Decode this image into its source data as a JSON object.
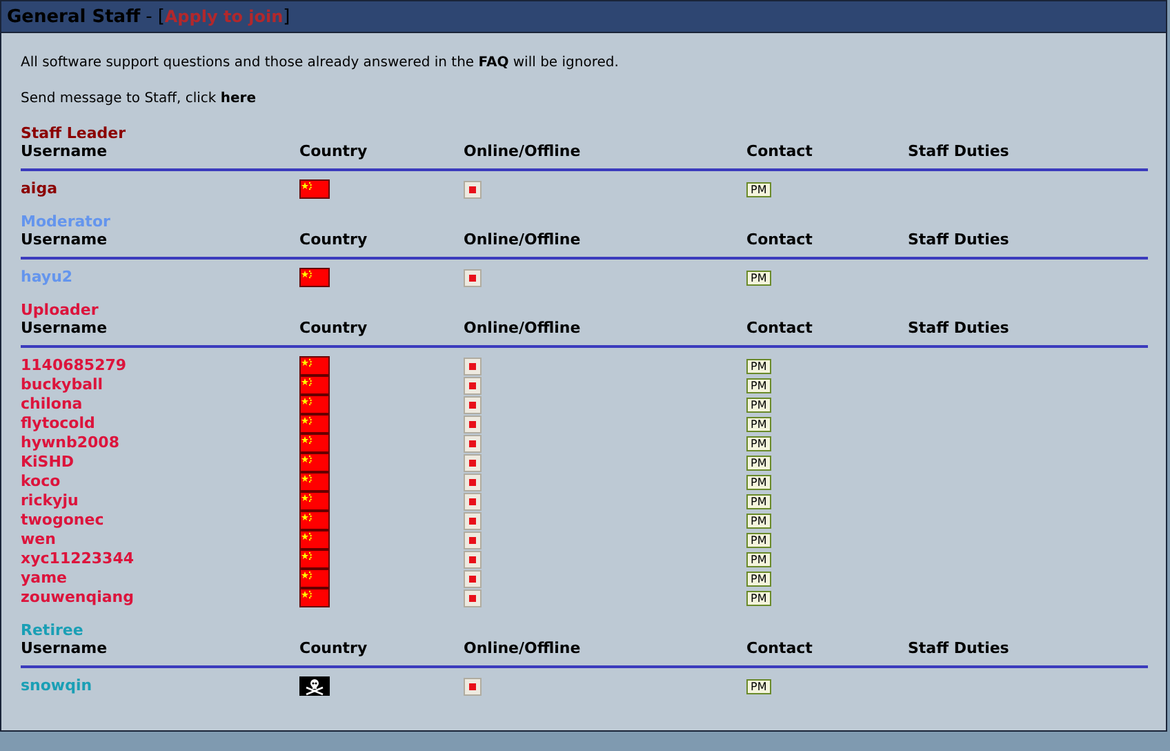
{
  "panel": {
    "title": "General Staff",
    "separator": "-",
    "bracket_open": "[",
    "join_link": "Apply to join",
    "bracket_close": "]"
  },
  "notice": "All software support questions and those already answered in the **FAQ** will be ignored.",
  "message": {
    "text": "Send message to Staff, click",
    "link": "here"
  },
  "groups": [
    {
      "name": "Staff Leader",
      "color": "#8b0000",
      "columns": [
        "Username",
        "Country",
        "Online/Offline",
        "Contact",
        "Staff Duties"
      ],
      "members": [
        {
          "username": "aiga",
          "kind": "china",
          "online": false,
          "contact": "PM"
        }
      ]
    },
    {
      "name": "Moderator",
      "color": "#6495ed",
      "columns": [
        "Username",
        "Country",
        "Online/Offline",
        "Contact",
        "Staff Duties"
      ],
      "members": [
        {
          "username": "hayu2",
          "kind": "china",
          "online": false,
          "contact": "PM"
        }
      ]
    },
    {
      "name": "Uploader",
      "color": "#dc143c",
      "columns": [
        "Username",
        "Country",
        "Online/Offline",
        "Contact",
        "Staff Duties"
      ],
      "members": [
        {
          "username": "1140685279",
          "kind": "china",
          "online": false,
          "contact": "PM"
        },
        {
          "username": "buckyball",
          "kind": "china",
          "online": false,
          "contact": "PM"
        },
        {
          "username": "chilona",
          "kind": "china",
          "online": false,
          "contact": "PM"
        },
        {
          "username": "flytocold",
          "kind": "china",
          "online": false,
          "contact": "PM"
        },
        {
          "username": "hywnb2008",
          "kind": "china",
          "online": false,
          "contact": "PM"
        },
        {
          "username": "KiSHD",
          "kind": "china",
          "online": false,
          "contact": "PM"
        },
        {
          "username": "koco",
          "kind": "china",
          "online": false,
          "contact": "PM"
        },
        {
          "username": "rickyju",
          "kind": "china",
          "online": false,
          "contact": "PM"
        },
        {
          "username": "twogonec",
          "kind": "china",
          "online": false,
          "contact": "PM"
        },
        {
          "username": "wen",
          "kind": "china",
          "online": false,
          "contact": "PM"
        },
        {
          "username": "xyc11223344",
          "kind": "china",
          "online": false,
          "contact": "PM"
        },
        {
          "username": "yame",
          "kind": "china",
          "online": false,
          "contact": "PM"
        },
        {
          "username": "zouwenqiang",
          "kind": "china",
          "online": false,
          "contact": "PM"
        }
      ]
    },
    {
      "name": "Retiree",
      "color": "#1a9fb5",
      "columns": [
        "Username",
        "Country",
        "Online/Offline",
        "Contact",
        "Staff Duties"
      ],
      "members": [
        {
          "username": "snowqin",
          "kind": "pirate",
          "online": false,
          "contact": "PM"
        }
      ]
    }
  ]
}
